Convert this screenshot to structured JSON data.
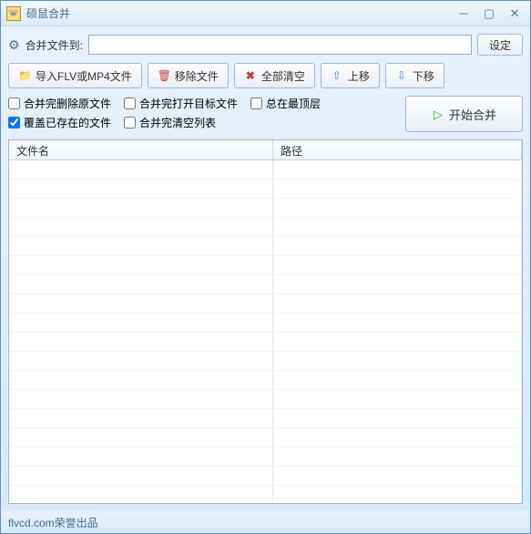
{
  "window": {
    "title": "硕鼠合并"
  },
  "mergeTo": {
    "label": "合并文件到:",
    "value": ""
  },
  "buttons": {
    "settings": "设定",
    "import": "导入FLV或MP4文件",
    "remove": "移除文件",
    "clear": "全部清空",
    "moveUp": "上移",
    "moveDown": "下移",
    "start": "开始合并"
  },
  "options": {
    "deleteSource": "合并完删除原文件",
    "openTarget": "合并完打开目标文件",
    "alwaysOnTop": "总在最顶层",
    "overwrite": "覆盖已存在的文件",
    "clearList": "合并完清空列表"
  },
  "columns": {
    "filename": "文件名",
    "path": "路径"
  },
  "footer": "flvcd.com荣誉出品"
}
